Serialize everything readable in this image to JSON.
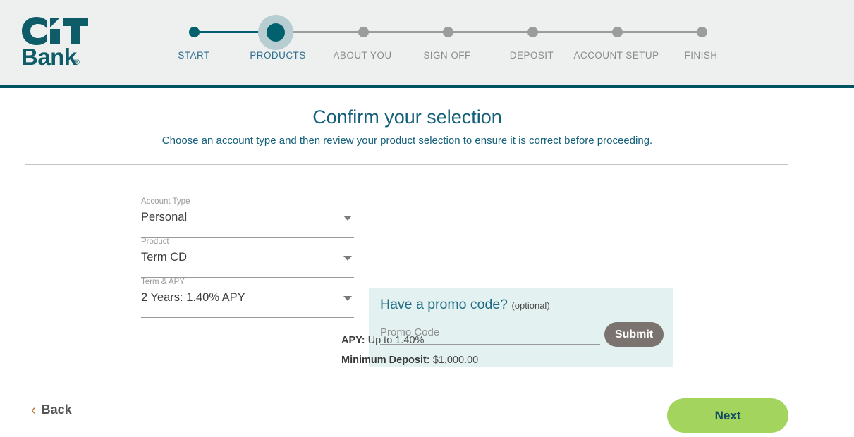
{
  "brand": {
    "logo_line1": "CiT",
    "logo_line2": "Bank",
    "logo_registered": "®",
    "color_primary": "#005461",
    "color_accent_green": "#a2d45e",
    "color_panel": "#e3f2f0"
  },
  "stepper": {
    "steps": [
      {
        "label": "START",
        "state": "done"
      },
      {
        "label": "PRODUCTS",
        "state": "current"
      },
      {
        "label": "ABOUT YOU",
        "state": "upcoming"
      },
      {
        "label": "SIGN OFF",
        "state": "upcoming"
      },
      {
        "label": "DEPOSIT",
        "state": "upcoming"
      },
      {
        "label": "ACCOUNT SETUP",
        "state": "upcoming"
      },
      {
        "label": "FINISH",
        "state": "upcoming"
      }
    ]
  },
  "page": {
    "title": "Confirm your selection",
    "subtitle": "Choose an account type and then review your product selection to ensure it is correct before proceeding."
  },
  "form": {
    "fields": [
      {
        "label": "Account Type",
        "value": "Personal"
      },
      {
        "label": "Product",
        "value": "Term CD"
      },
      {
        "label": "Term & APY",
        "value": "2 Years: 1.40% APY"
      }
    ]
  },
  "promo": {
    "title": "Have a promo code?",
    "optional": "(optional)",
    "placeholder": "Promo Code",
    "value": "",
    "submit_label": "Submit"
  },
  "details": {
    "apy_label": "APY:",
    "apy_value": "Up to 1.40%",
    "min_deposit_label": "Minimum Deposit:",
    "min_deposit_value": "$1,000.00"
  },
  "nav": {
    "back_chevron": "‹",
    "back_label": "Back",
    "next_label": "Next"
  }
}
